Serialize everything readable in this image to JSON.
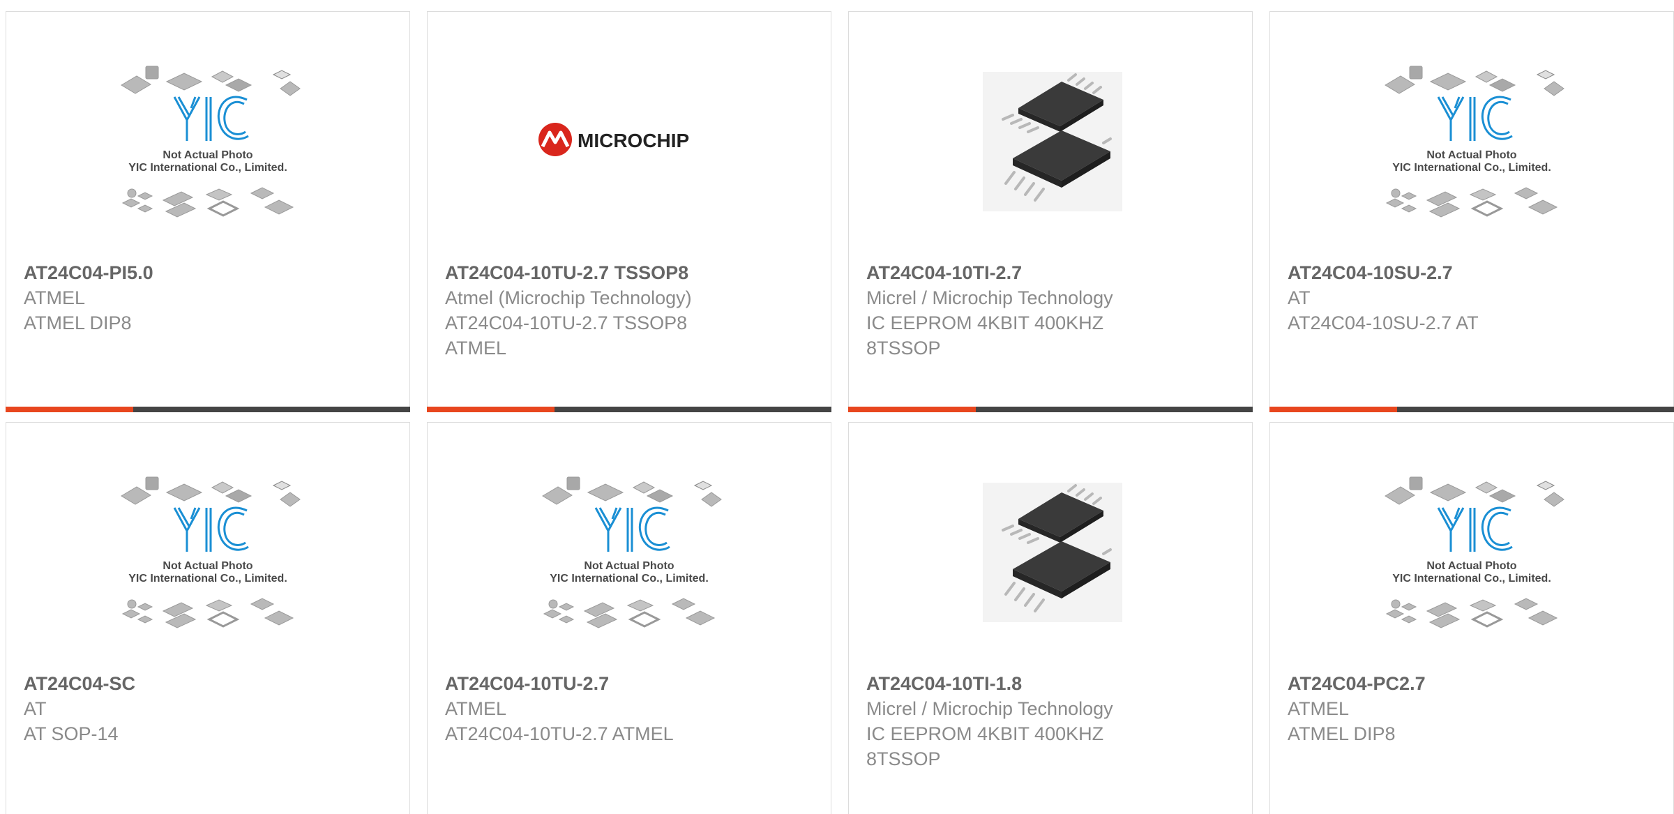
{
  "colors": {
    "accent": "#e8461e",
    "bar_dark": "#444444",
    "card_border": "#dcdcdc",
    "title_text": "#666666",
    "detail_text": "#8a8a8a",
    "yic_blue": "#1a8fd4",
    "microchip_red": "#d9261c"
  },
  "placeholder": {
    "line1": "Not Actual Photo",
    "line2": "YIC International Co., Limited.",
    "logo_text": "YIC"
  },
  "microchip_logo_text": "MICROCHIP",
  "products": [
    {
      "part_number": "AT24C04-PI5.0",
      "manufacturer": "ATMEL",
      "description": [
        "ATMEL DIP8"
      ],
      "image": "yic-placeholder"
    },
    {
      "part_number": "AT24C04-10TU-2.7 TSSOP8",
      "manufacturer": "Atmel (Microchip Technology)",
      "description": [
        "AT24C04-10TU-2.7 TSSOP8",
        "ATMEL"
      ],
      "image": "microchip-logo"
    },
    {
      "part_number": "AT24C04-10TI-2.7",
      "manufacturer": "Micrel / Microchip Technology",
      "description": [
        "IC EEPROM 4KBIT 400KHZ",
        "8TSSOP"
      ],
      "image": "tssop-chip-photo"
    },
    {
      "part_number": "AT24C04-10SU-2.7",
      "manufacturer": "AT",
      "description": [
        "AT24C04-10SU-2.7 AT"
      ],
      "image": "yic-placeholder"
    },
    {
      "part_number": "AT24C04-SC",
      "manufacturer": "AT",
      "description": [
        "AT SOP-14"
      ],
      "image": "yic-placeholder"
    },
    {
      "part_number": "AT24C04-10TU-2.7",
      "manufacturer": "ATMEL",
      "description": [
        "AT24C04-10TU-2.7 ATMEL"
      ],
      "image": "yic-placeholder"
    },
    {
      "part_number": "AT24C04-10TI-1.8",
      "manufacturer": "Micrel / Microchip Technology",
      "description": [
        "IC EEPROM 4KBIT 400KHZ",
        "8TSSOP"
      ],
      "image": "tssop-chip-photo"
    },
    {
      "part_number": "AT24C04-PC2.7",
      "manufacturer": "ATMEL",
      "description": [
        "ATMEL DIP8"
      ],
      "image": "yic-placeholder"
    }
  ]
}
